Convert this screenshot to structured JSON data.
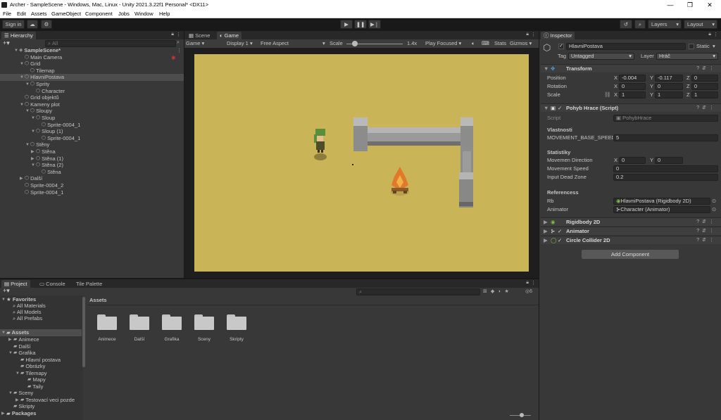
{
  "window": {
    "title": "Archer - SampleScene - Windows, Mac, Linux - Unity 2021.3.22f1 Personal* <DX11>",
    "minimize": "—",
    "maximize": "❐",
    "close": "✕"
  },
  "menu": [
    "File",
    "Edit",
    "Assets",
    "GameObject",
    "Component",
    "Jobs",
    "Window",
    "Help"
  ],
  "toolbar": {
    "signin": "Sign in",
    "layers": "Layers",
    "layout": "Layout"
  },
  "hierarchy": {
    "tab": "Hierarchy",
    "search_placeholder": "All",
    "items": [
      {
        "label": "SampleScene*",
        "depth": 0,
        "arrow": "▼",
        "icon": "◈",
        "selected": false,
        "bold": true
      },
      {
        "label": "Main Camera",
        "depth": 1,
        "arrow": "",
        "icon": "⬡"
      },
      {
        "label": "Grid",
        "depth": 1,
        "arrow": "▼",
        "icon": "⬡"
      },
      {
        "label": "Tilemap",
        "depth": 2,
        "arrow": "",
        "icon": "⬡"
      },
      {
        "label": "HlavniPostava",
        "depth": 1,
        "arrow": "▼",
        "icon": "⬡",
        "selected": true
      },
      {
        "label": "Sprity",
        "depth": 2,
        "arrow": "▼",
        "icon": "⬡"
      },
      {
        "label": "Character",
        "depth": 3,
        "arrow": "",
        "icon": "⬡"
      },
      {
        "label": "Grid objektů",
        "depth": 1,
        "arrow": "",
        "icon": "⬡"
      },
      {
        "label": "Kameny plot",
        "depth": 1,
        "arrow": "▼",
        "icon": "⬡"
      },
      {
        "label": "Sloupy",
        "depth": 2,
        "arrow": "▼",
        "icon": "⬡"
      },
      {
        "label": "Sloup",
        "depth": 3,
        "arrow": "▼",
        "icon": "⬡"
      },
      {
        "label": "Sprite-0004_1",
        "depth": 4,
        "arrow": "",
        "icon": "⬡"
      },
      {
        "label": "Sloup (1)",
        "depth": 3,
        "arrow": "▼",
        "icon": "⬡"
      },
      {
        "label": "Sprite-0004_1",
        "depth": 4,
        "arrow": "",
        "icon": "⬡"
      },
      {
        "label": "Stěny",
        "depth": 2,
        "arrow": "▼",
        "icon": "⬡"
      },
      {
        "label": "Stěna",
        "depth": 3,
        "arrow": "▶",
        "icon": "⬡"
      },
      {
        "label": "Stěna (1)",
        "depth": 3,
        "arrow": "▶",
        "icon": "⬡"
      },
      {
        "label": "Stěna (2)",
        "depth": 3,
        "arrow": "▼",
        "icon": "⬡"
      },
      {
        "label": "Stěna",
        "depth": 4,
        "arrow": "",
        "icon": "⬡"
      },
      {
        "label": "Další",
        "depth": 1,
        "arrow": "▶",
        "icon": "⬡"
      },
      {
        "label": "Sprite-0004_2",
        "depth": 1,
        "arrow": "",
        "icon": "⬡"
      },
      {
        "label": "Sprite-0004_1",
        "depth": 1,
        "arrow": "",
        "icon": "⬡"
      }
    ]
  },
  "game": {
    "tabs": [
      "Scene",
      "Game"
    ],
    "display_mode": "Game",
    "display": "Display 1",
    "aspect": "Free Aspect",
    "scale_label": "Scale",
    "scale_value": "1.4x",
    "play_mode": "Play Focused",
    "stats": "Stats",
    "gizmos": "Gizmos",
    "scale_fraction": 0.15
  },
  "inspector": {
    "tab": "Inspector",
    "object_name": "HlavniPostava",
    "static_label": "Static",
    "tag_label": "Tag",
    "tag_value": "Untagged",
    "layer_label": "Layer",
    "layer_value": "Hráč",
    "transform": {
      "title": "Transform",
      "position_label": "Position",
      "rotation_label": "Rotation",
      "scale_label": "Scale",
      "position": {
        "x": "-0.004",
        "y": "-0.117",
        "z": "0"
      },
      "rotation": {
        "x": "0",
        "y": "0",
        "z": "0"
      },
      "scale": {
        "x": "1",
        "y": "1",
        "z": "1"
      }
    },
    "script_comp": {
      "title": "Pohyb Hrace (Script)",
      "script_label": "Script",
      "script_value": "PohybHrace",
      "section1": "Vlastnosti",
      "speed_label": "MOVEMENT_BASE_SPEED",
      "speed_value": "5",
      "section2": "Statistiky",
      "dir_label": "Movemen Direction",
      "dir_x": "0",
      "dir_y": "0",
      "mspeed_label": "Movement Speed",
      "mspeed_value": "0",
      "deadzone_label": "Input Dead Zone",
      "deadzone_value": "0.2",
      "section3": "Referencess",
      "rb_label": "Rb",
      "rb_value": "HlavniPostava (Rigidbody 2D)",
      "anim_label": "Animator",
      "anim_value": "Character (Animator)"
    },
    "rigidbody": "Rigidbody 2D",
    "animator": "Animator",
    "collider": "Circle Collider 2D",
    "add_component": "Add Component"
  },
  "project": {
    "tabs": [
      "Project",
      "Console",
      "Tile Palette"
    ],
    "favorites_label": "Favorites",
    "favorites": [
      "All Materials",
      "All Models",
      "All Prefabs"
    ],
    "assets_label": "Assets",
    "tree": [
      {
        "label": "Animece",
        "depth": 1,
        "arrow": "▶"
      },
      {
        "label": "Další",
        "depth": 1,
        "arrow": ""
      },
      {
        "label": "Grafika",
        "depth": 1,
        "arrow": "▼"
      },
      {
        "label": "Hlavní postava",
        "depth": 2,
        "arrow": ""
      },
      {
        "label": "Obrázky",
        "depth": 2,
        "arrow": ""
      },
      {
        "label": "Tilemapy",
        "depth": 2,
        "arrow": "▼"
      },
      {
        "label": "Mapy",
        "depth": 3,
        "arrow": ""
      },
      {
        "label": "Taily",
        "depth": 3,
        "arrow": ""
      },
      {
        "label": "Sceny",
        "depth": 1,
        "arrow": "▼"
      },
      {
        "label": "Testovací veci pozde",
        "depth": 2,
        "arrow": "▶"
      },
      {
        "label": "Skripty",
        "depth": 1,
        "arrow": ""
      }
    ],
    "packages_label": "Packages",
    "breadcrumb": "Assets",
    "badge": "6",
    "folders": [
      "Animece",
      "Další",
      "Grafika",
      "Sceny",
      "Skripty"
    ]
  },
  "colors": {
    "game_bg": "#c9b458",
    "accent": "#3a72b0"
  }
}
